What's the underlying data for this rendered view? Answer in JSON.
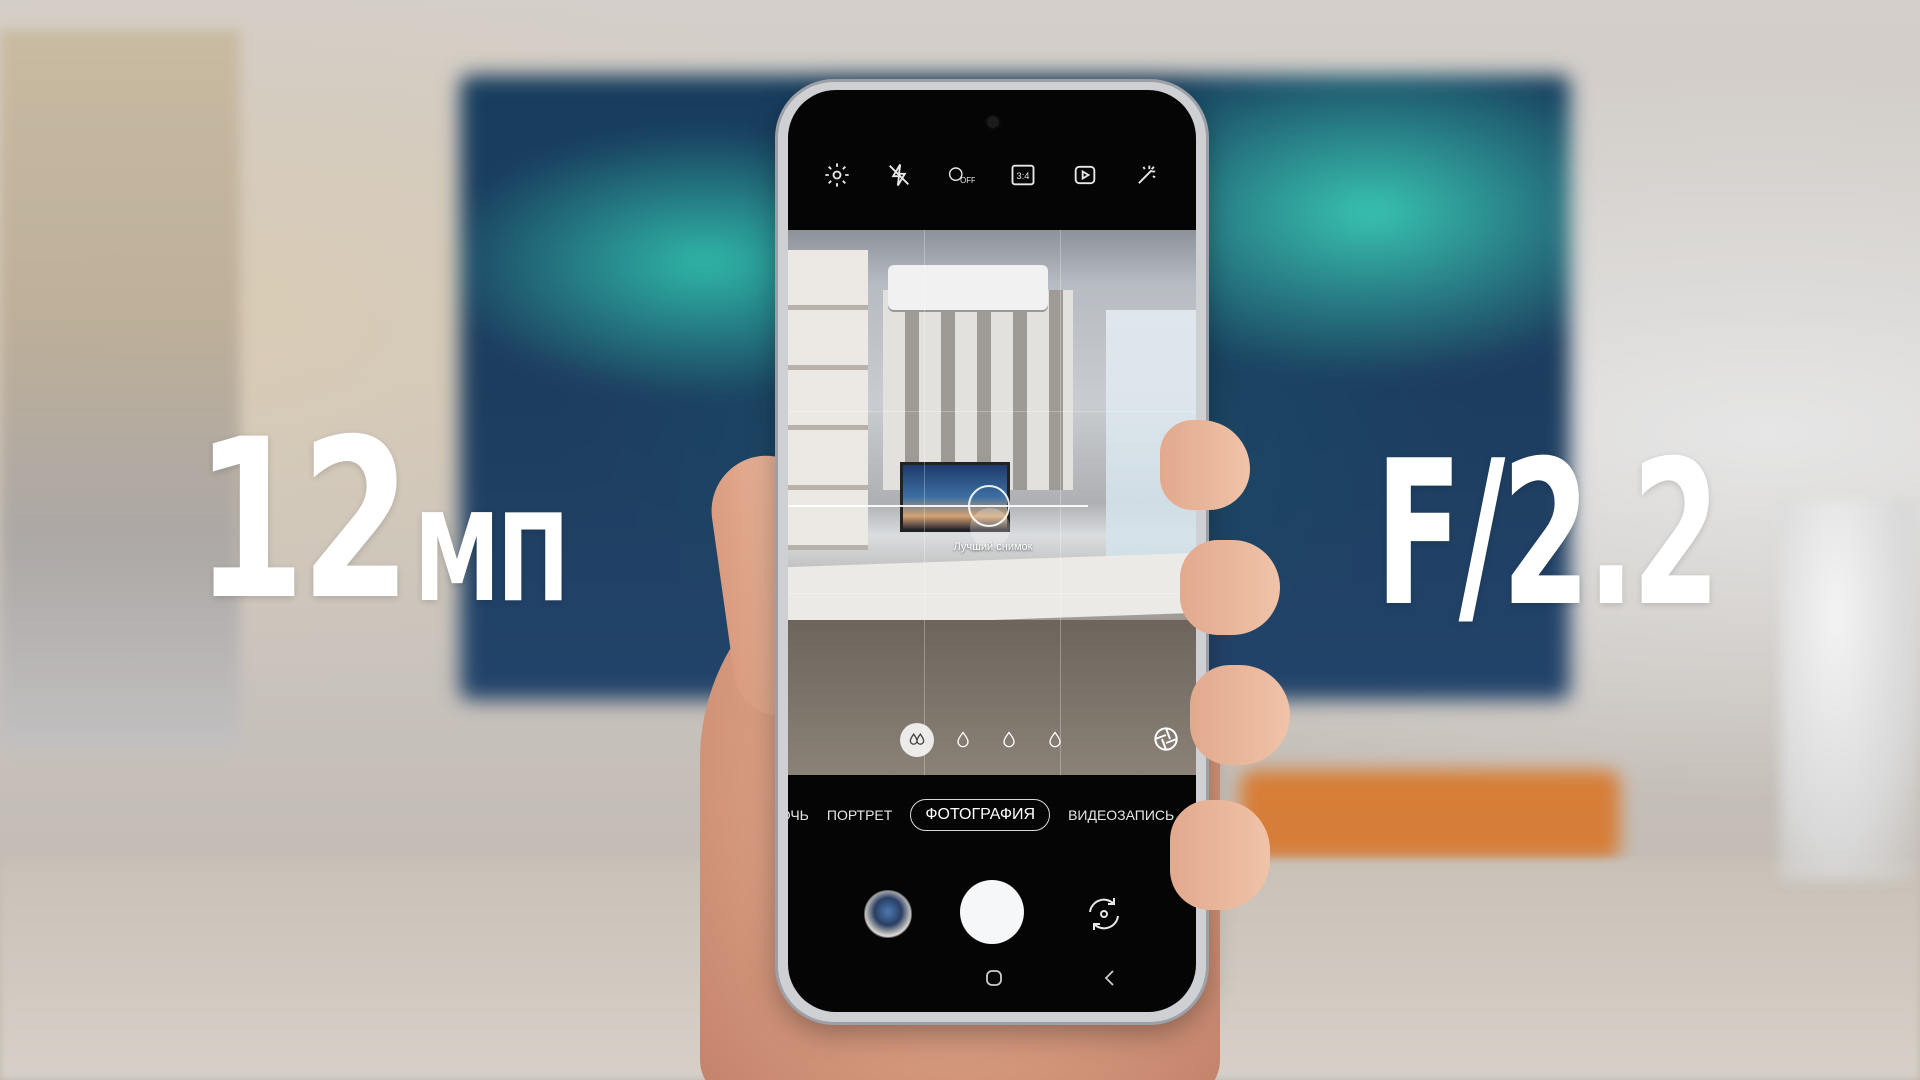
{
  "overlay": {
    "megapixels_number": "12",
    "megapixels_unit": "МП",
    "aperture": "F/2.2"
  },
  "camera_app": {
    "top_icons": [
      "gear-icon",
      "flash-off-icon",
      "timer-off-icon",
      "aspect-ratio-icon",
      "motion-photo-icon",
      "effects-icon"
    ],
    "aspect_ratio_label": "3:4",
    "timer_label": "OFF",
    "best_shot_label": "Лучший снимок",
    "filter_icons": [
      "all-filters-icon",
      "filter-droplet-icon",
      "filter-droplet-icon",
      "filter-droplet-icon"
    ],
    "modes": [
      "ОЧЬ",
      "ПОРТРЕТ",
      "ФОТОГРАФИЯ",
      "ВИДЕОЗАПИСЬ"
    ],
    "selected_mode": "ФОТОГРАФИЯ"
  },
  "colors": {
    "overlay_text": "#ffffff",
    "shutter": "#f6f7f9",
    "screen_bg": "#050505"
  }
}
